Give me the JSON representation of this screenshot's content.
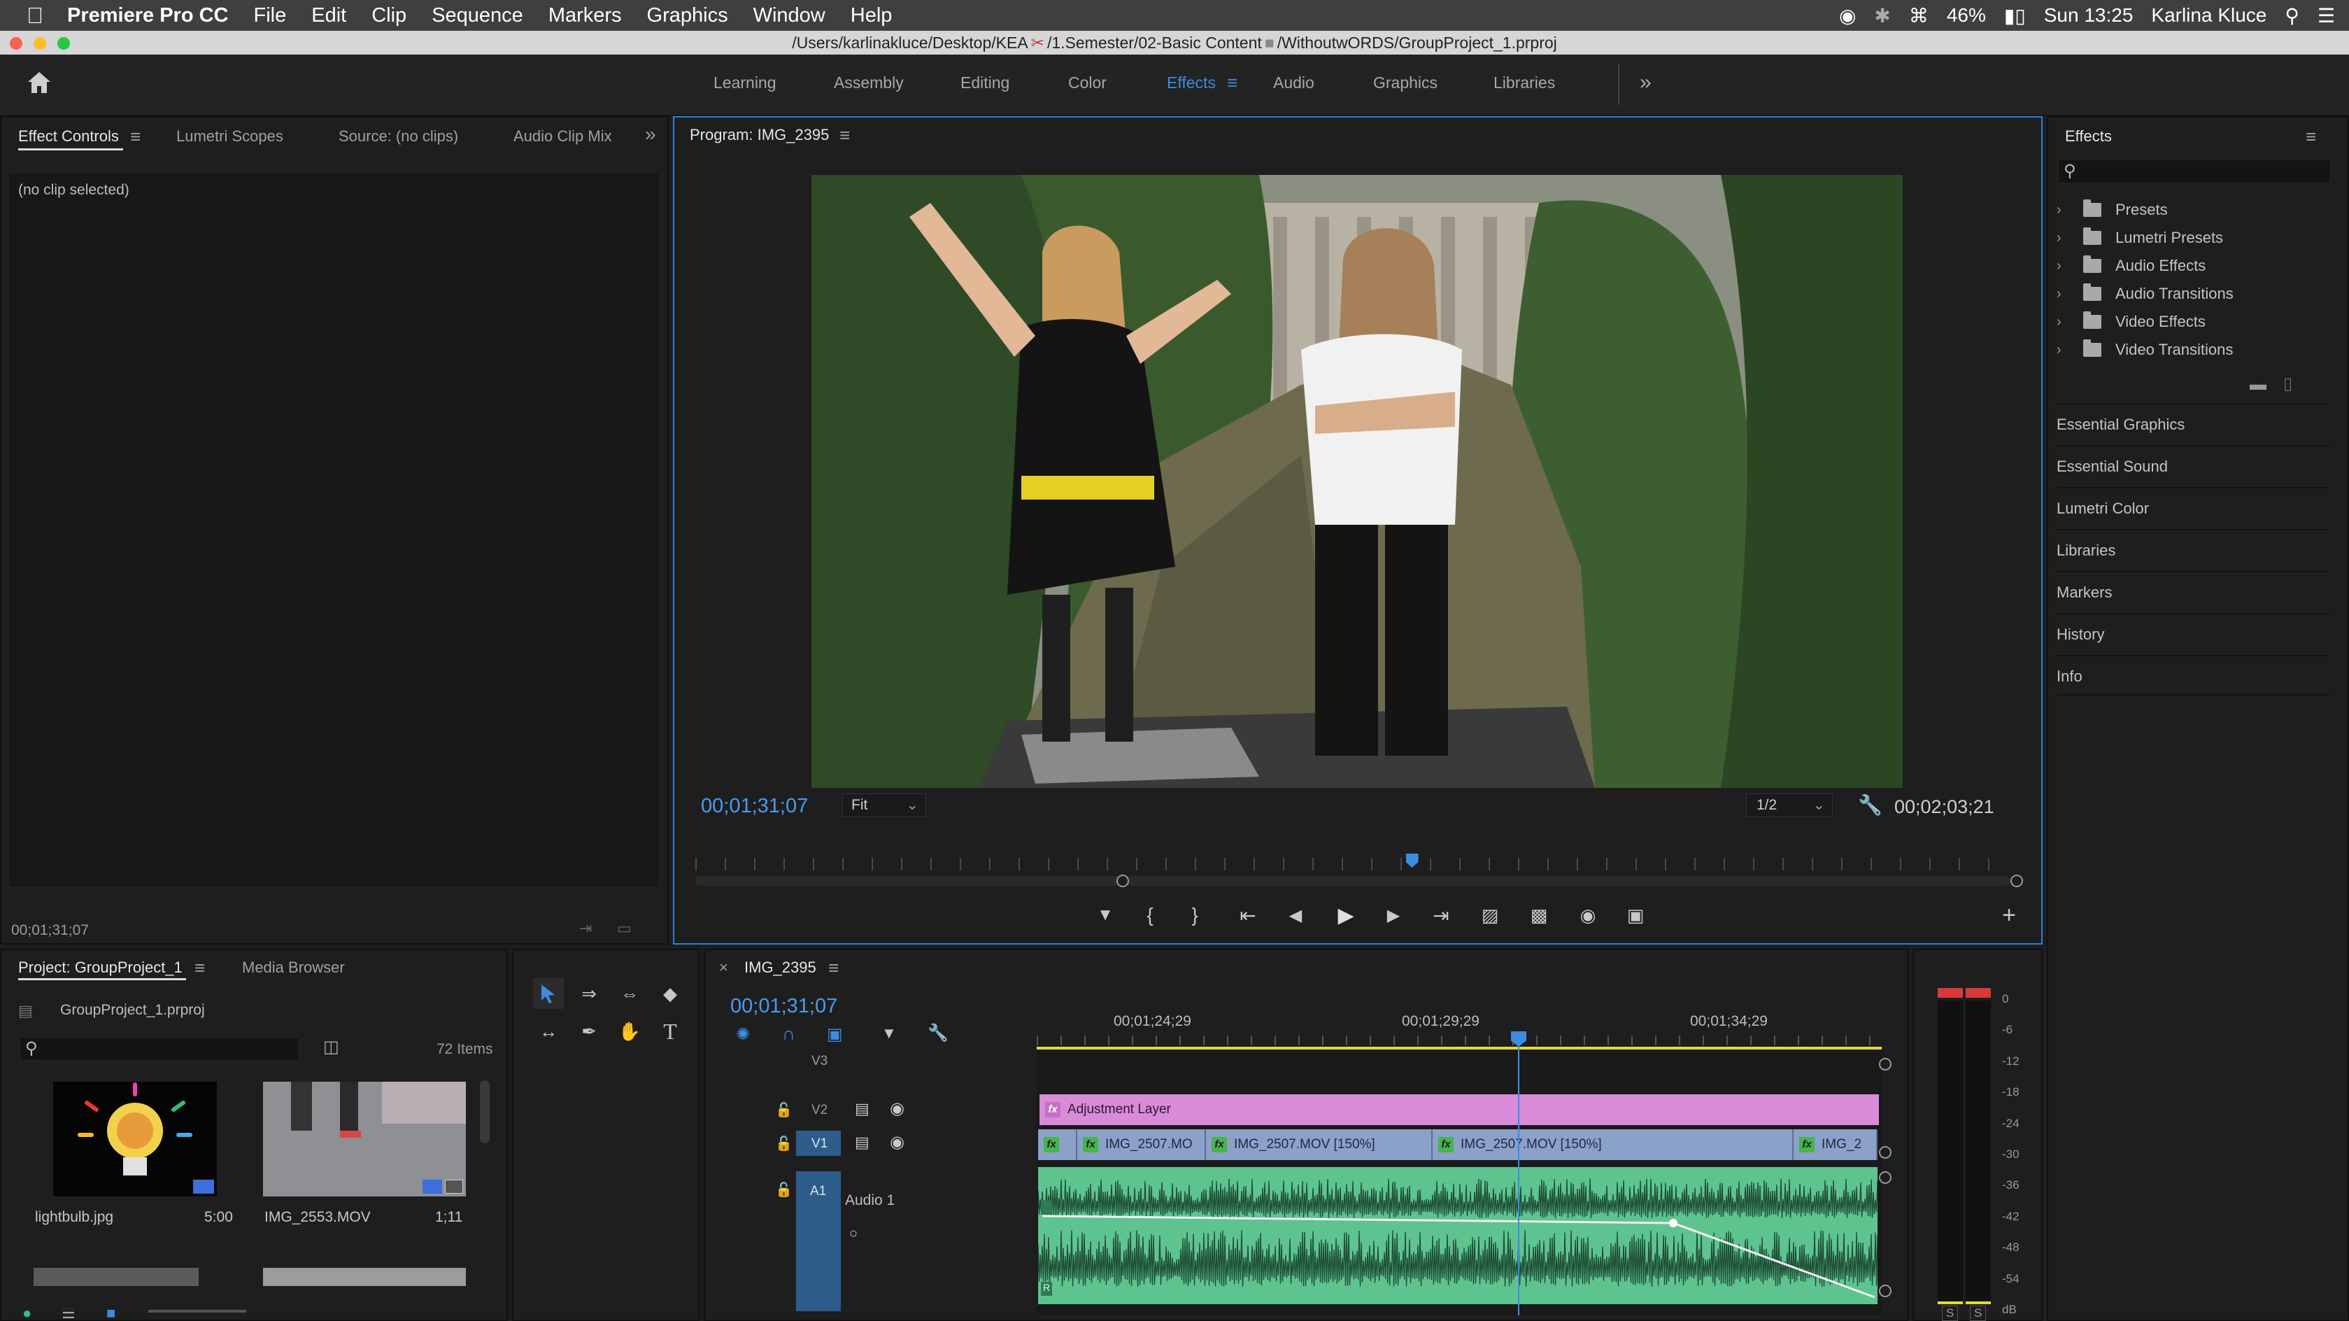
{
  "menubar": {
    "app_name": "Premiere Pro CC",
    "items": [
      "File",
      "Edit",
      "Clip",
      "Sequence",
      "Markers",
      "Graphics",
      "Window",
      "Help"
    ],
    "battery": "46%",
    "clock": "Sun 13:25",
    "user": "Karlina Kluce"
  },
  "titlebar": {
    "path_part1": "/Users/karlinakluce/Desktop/KEA",
    "path_part2": "/1.Semester/02-Basic Content",
    "path_part3": "/WithoutwORDS/GroupProject_1.prproj"
  },
  "workspaces": {
    "items": [
      "Learning",
      "Assembly",
      "Editing",
      "Color",
      "Effects",
      "Audio",
      "Graphics",
      "Libraries"
    ],
    "active": "Effects"
  },
  "source_panel": {
    "tabs": [
      "Effect Controls",
      "Lumetri Scopes",
      "Source: (no clips)",
      "Audio Clip Mix"
    ],
    "no_clip": "(no clip selected)",
    "timecode": "00;01;31;07"
  },
  "program": {
    "title": "Program: IMG_2395",
    "timecode": "00;01;31;07",
    "fit": "Fit",
    "resolution": "1/2",
    "duration": "00;02;03;21",
    "playhead_fraction": 0.545
  },
  "effects_panel": {
    "title": "Effects",
    "folders": [
      "Presets",
      "Lumetri Presets",
      "Audio Effects",
      "Audio Transitions",
      "Video Effects",
      "Video Transitions"
    ],
    "sections": [
      "Essential Graphics",
      "Essential Sound",
      "Lumetri Color",
      "Libraries",
      "Markers",
      "History",
      "Info"
    ]
  },
  "project": {
    "tabs": [
      "Project: GroupProject_1",
      "Media Browser"
    ],
    "file": "GroupProject_1.prproj",
    "count": "72 Items",
    "items": [
      {
        "name": "lightbulb.jpg",
        "duration": "5:00"
      },
      {
        "name": "IMG_2553.MOV",
        "duration": "1;11"
      }
    ]
  },
  "timeline": {
    "title": "IMG_2395",
    "timecode": "00;01;31;07",
    "ruler": [
      "00;01;24;29",
      "00;01;29;29",
      "00;01;34;29"
    ],
    "tracks": {
      "v3": "V3",
      "v2": "V2",
      "v1": "V1",
      "a1": "A1",
      "a1_name": "Audio 1"
    },
    "adjustment": "Adjustment Layer",
    "clips": [
      "IMG_2507.MO",
      "IMG_2507.MOV [150%]",
      "IMG_2507.MOV [150%]",
      "IMG_2"
    ]
  },
  "meters": {
    "labels": [
      "0",
      "-6",
      "-12",
      "-18",
      "-24",
      "-30",
      "-36",
      "-42",
      "-48",
      "-54",
      "dB"
    ],
    "solo": [
      "S",
      "S"
    ]
  },
  "colors": {
    "accent": "#3d8ce0",
    "adjustment": "#d98ad9",
    "video_clip": "#8ba1c9",
    "audio_clip": "#5ec48f"
  }
}
